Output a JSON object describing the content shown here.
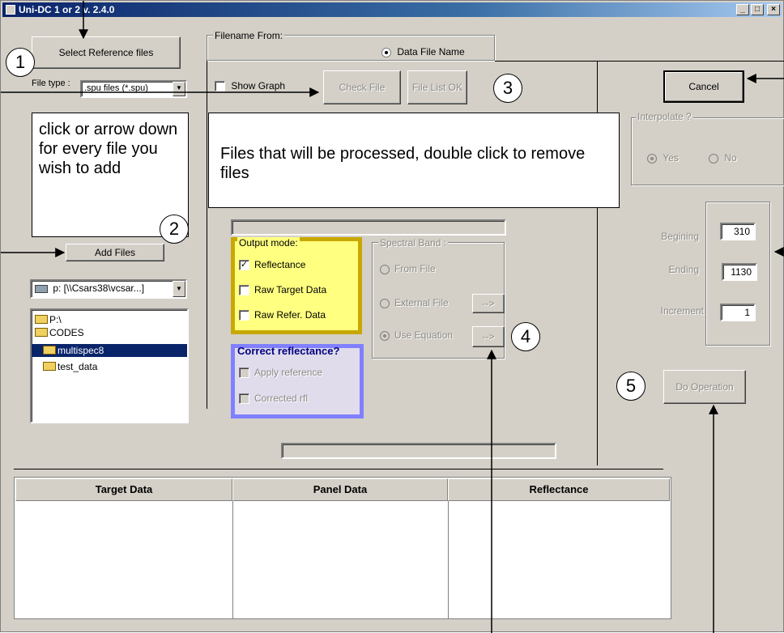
{
  "window": {
    "title": "Uni-DC 1 or 2 v. 2.4.0",
    "minimize_label": "_",
    "maximize_label": "□",
    "close_label": "×"
  },
  "buttons": {
    "select_reference": "Select Reference files",
    "add_files": "Add Files",
    "check_file": "Check File",
    "file_list_ok": "File List OK",
    "cancel": "Cancel",
    "do_operation": "Do Operation",
    "arrow_external": "-->",
    "arrow_equation": "-->"
  },
  "file_type": {
    "label": "File type :",
    "selected": ".spu files  (*.spu)"
  },
  "filename_from": {
    "label": "Filename From:",
    "option": "Data File Name"
  },
  "show_graph_label": "Show Graph",
  "drive_select": "p: [\\\\Csars38\\vcsar...]",
  "tree": {
    "items": [
      "P:\\",
      "CODES",
      "multispec8",
      "test_data"
    ],
    "selected_index": 2
  },
  "output_mode": {
    "label": "Output mode:",
    "options": [
      {
        "label": "Reflectance",
        "checked": true
      },
      {
        "label": "Raw Target Data",
        "checked": false
      },
      {
        "label": "Raw Refer. Data",
        "checked": false
      }
    ]
  },
  "correct_reflectance": {
    "label": "Correct reflectance?",
    "options": [
      {
        "label": "Apply reference",
        "checked": false
      },
      {
        "label": "Corrected rfl",
        "checked": false
      }
    ]
  },
  "spectral_band": {
    "label": "Spectral Band :",
    "options": [
      "From File",
      "External File",
      "Use Equation"
    ],
    "selected_index": 2
  },
  "interpolate": {
    "label": "Interpolate ?",
    "yes": "Yes",
    "no": "No",
    "selected": "Yes"
  },
  "range": {
    "begin_label": "Begining",
    "end_label": "Ending",
    "increment_label": "Increment",
    "begin": "310",
    "end": "1130",
    "increment": "1"
  },
  "table": {
    "columns": [
      "Target Data",
      "Panel Data",
      "Reflectance"
    ]
  },
  "annotations": {
    "note_left": "click or arrow down for every file you wish to add",
    "note_center": "Files that will be processed, double click to remove files",
    "callouts": [
      "1",
      "2",
      "3",
      "4",
      "5"
    ]
  },
  "colors": {
    "output_mode_bg": "#ffff80",
    "output_mode_border": "#c8a800",
    "correct_bg": "#e0dcec",
    "correct_border": "#8080ff"
  }
}
